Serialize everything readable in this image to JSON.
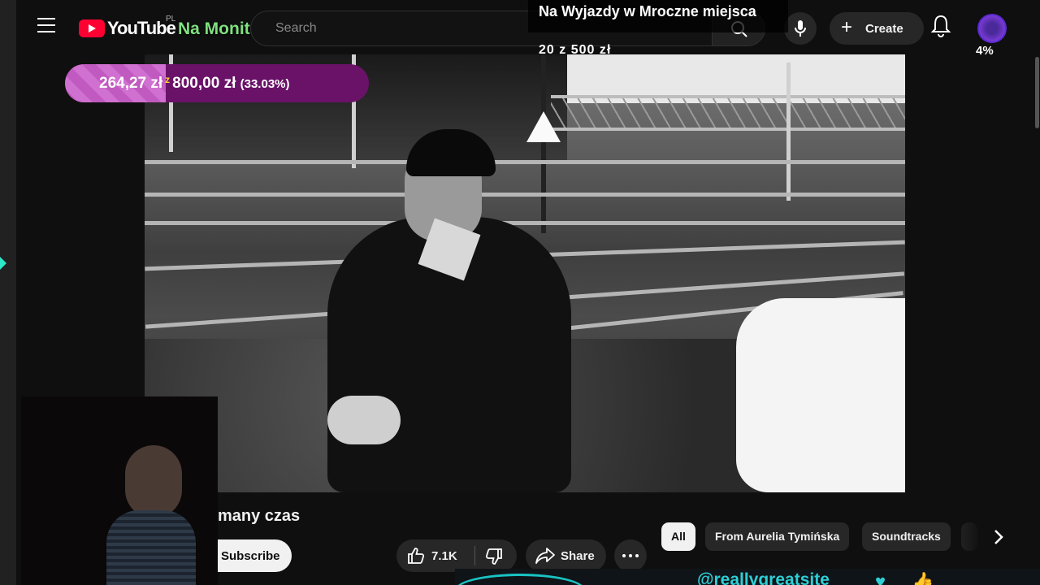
{
  "header": {
    "logo_wordmark": "YouTube",
    "region_code": "PL",
    "channel_overlay_title": "Na Monitor",
    "search_placeholder": "Search",
    "create_label": "Create",
    "avatar_badge": "4%"
  },
  "goal_overlay": {
    "title": "Na Wyjazdy w Mroczne miejsca",
    "amount": "20 z 500 zł"
  },
  "donation_bar": {
    "current": "264,27 zł",
    "separator": "z",
    "target": "800,00 zł",
    "percent_text": "(33.03%)",
    "fill_fraction": 0.3303,
    "fill_color": "#c05ac0",
    "bar_color": "#6a1268"
  },
  "video": {
    "title": "many czas",
    "subscribe_label": "Subscribe",
    "like_count": "7.1K",
    "share_label": "Share"
  },
  "chips": [
    {
      "label": "All",
      "active": true
    },
    {
      "label": "From Aurelia Tymińska",
      "active": false
    },
    {
      "label": "Soundtracks",
      "active": false
    }
  ],
  "stream_footer": {
    "site_handle": "@reallygreatsite",
    "accent_color": "#2ecfd6"
  },
  "icons": [
    "menu-icon",
    "youtube-logo-icon",
    "search-icon",
    "mic-icon",
    "plus-icon",
    "bell-icon",
    "like-icon",
    "dislike-icon",
    "share-icon",
    "more-icon",
    "chevron-right-icon",
    "heart-icon",
    "thumbs-up-icon"
  ]
}
